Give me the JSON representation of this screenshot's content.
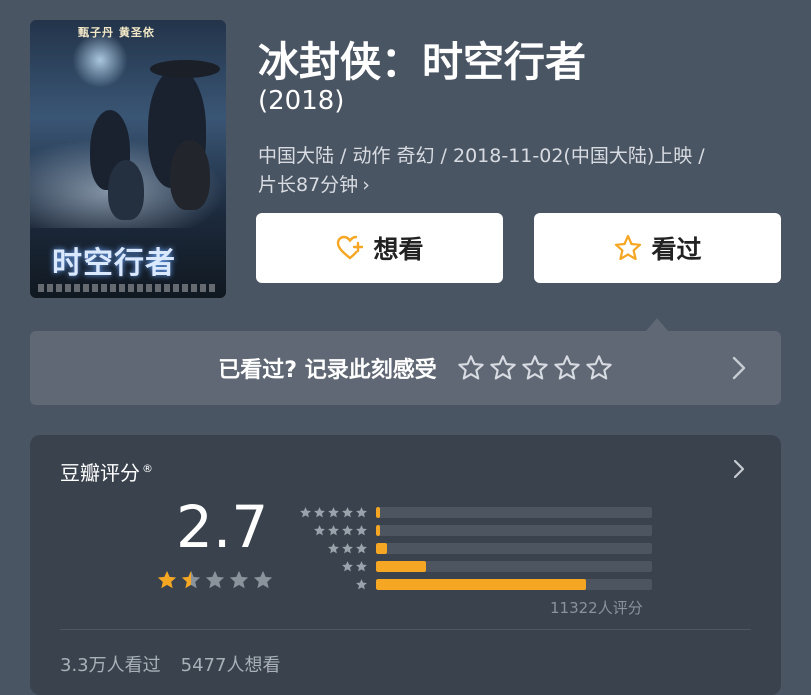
{
  "movie": {
    "title": "冰封侠：时空行者",
    "year": "(2018)",
    "meta_line1": "中国大陆 / 动作 奇幻 / 2018-11-02(中国大陆)上映 /",
    "meta_line2": "片长87分钟",
    "poster": {
      "top_text": "甄子丹 黄圣依",
      "title_text": "时空行者"
    }
  },
  "actions": {
    "want_label": "想看",
    "seen_label": "看过"
  },
  "record": {
    "prompt": "已看过? 记录此刻感受",
    "stars_total": 5
  },
  "rating": {
    "label": "豆瓣评分",
    "label_mark": "®",
    "score": "2.7",
    "stars_filled": 1.5,
    "distribution": [
      {
        "stars": 5,
        "fraction": 0.01
      },
      {
        "stars": 4,
        "fraction": 0.01
      },
      {
        "stars": 3,
        "fraction": 0.04
      },
      {
        "stars": 2,
        "fraction": 0.18
      },
      {
        "stars": 1,
        "fraction": 0.76
      }
    ],
    "count_text": "11322人评分",
    "watched_text": "3.3万人看过",
    "want_text": "5477人想看"
  },
  "colors": {
    "background": "#4a5563",
    "accent": "#f5a623",
    "star_empty": "#8a929c"
  }
}
